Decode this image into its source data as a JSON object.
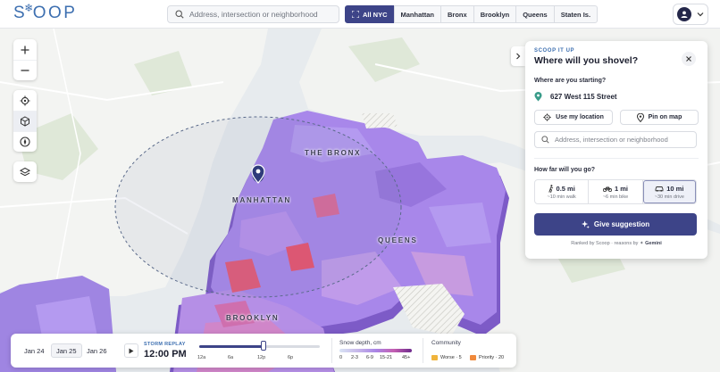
{
  "app": {
    "logo": "SCOOP"
  },
  "header": {
    "search_placeholder": "Address, intersection or neighborhood",
    "borough_tabs": [
      "All NYC",
      "Manhattan",
      "Bronx",
      "Brooklyn",
      "Queens",
      "Staten Is."
    ],
    "active_tab": "All NYC"
  },
  "map": {
    "labels": {
      "bronx": "THE BRONX",
      "manhattan": "MANHATTAN",
      "queens": "QUEENS",
      "brooklyn": "BROOKLYN"
    }
  },
  "panel": {
    "eyebrow": "SCOOP IT UP",
    "title": "Where will you shovel?",
    "start_question": "Where are you starting?",
    "start_address": "627 West 115 Street",
    "use_location": "Use my location",
    "pin_on_map": "Pin on map",
    "input_placeholder": "Address, intersection or neighborhood",
    "distance_question": "How far will you go?",
    "distances": [
      {
        "label": "0.5 mi",
        "sub": "~10 min walk",
        "icon": "walk-icon"
      },
      {
        "label": "1 mi",
        "sub": "~6 min bike",
        "icon": "bike-icon"
      },
      {
        "label": "10 mi",
        "sub": "~30 min drive",
        "icon": "car-icon"
      }
    ],
    "selected_distance": "10 mi",
    "cta": "Give suggestion",
    "ranked_prefix": "Ranked by Scoop · reasons by",
    "ranked_brand": "Gemini"
  },
  "bottom": {
    "days": [
      "Jan 24",
      "Jan 25",
      "Jan 26"
    ],
    "selected_day": "Jan 25",
    "replay_label": "STORM REPLAY",
    "replay_time": "12:00 PM",
    "slider_progress": 0.53,
    "time_ticks": [
      "12a",
      "6a",
      "12p",
      "6p"
    ],
    "snow_title": "Snow depth, cm",
    "snow_labels": [
      "0",
      "2-3",
      "6-9",
      "15-21",
      "45+"
    ],
    "community_title": "Community",
    "community_items": [
      {
        "label": "Worse · 5",
        "color": "#f0b43c"
      },
      {
        "label": "Priority · 20",
        "color": "#f08a3c"
      }
    ]
  },
  "colors": {
    "accent": "#3d4488",
    "brand": "#3d6fb0",
    "snow_low": "#c7b8ea",
    "snow_high": "#6d2a8c"
  }
}
